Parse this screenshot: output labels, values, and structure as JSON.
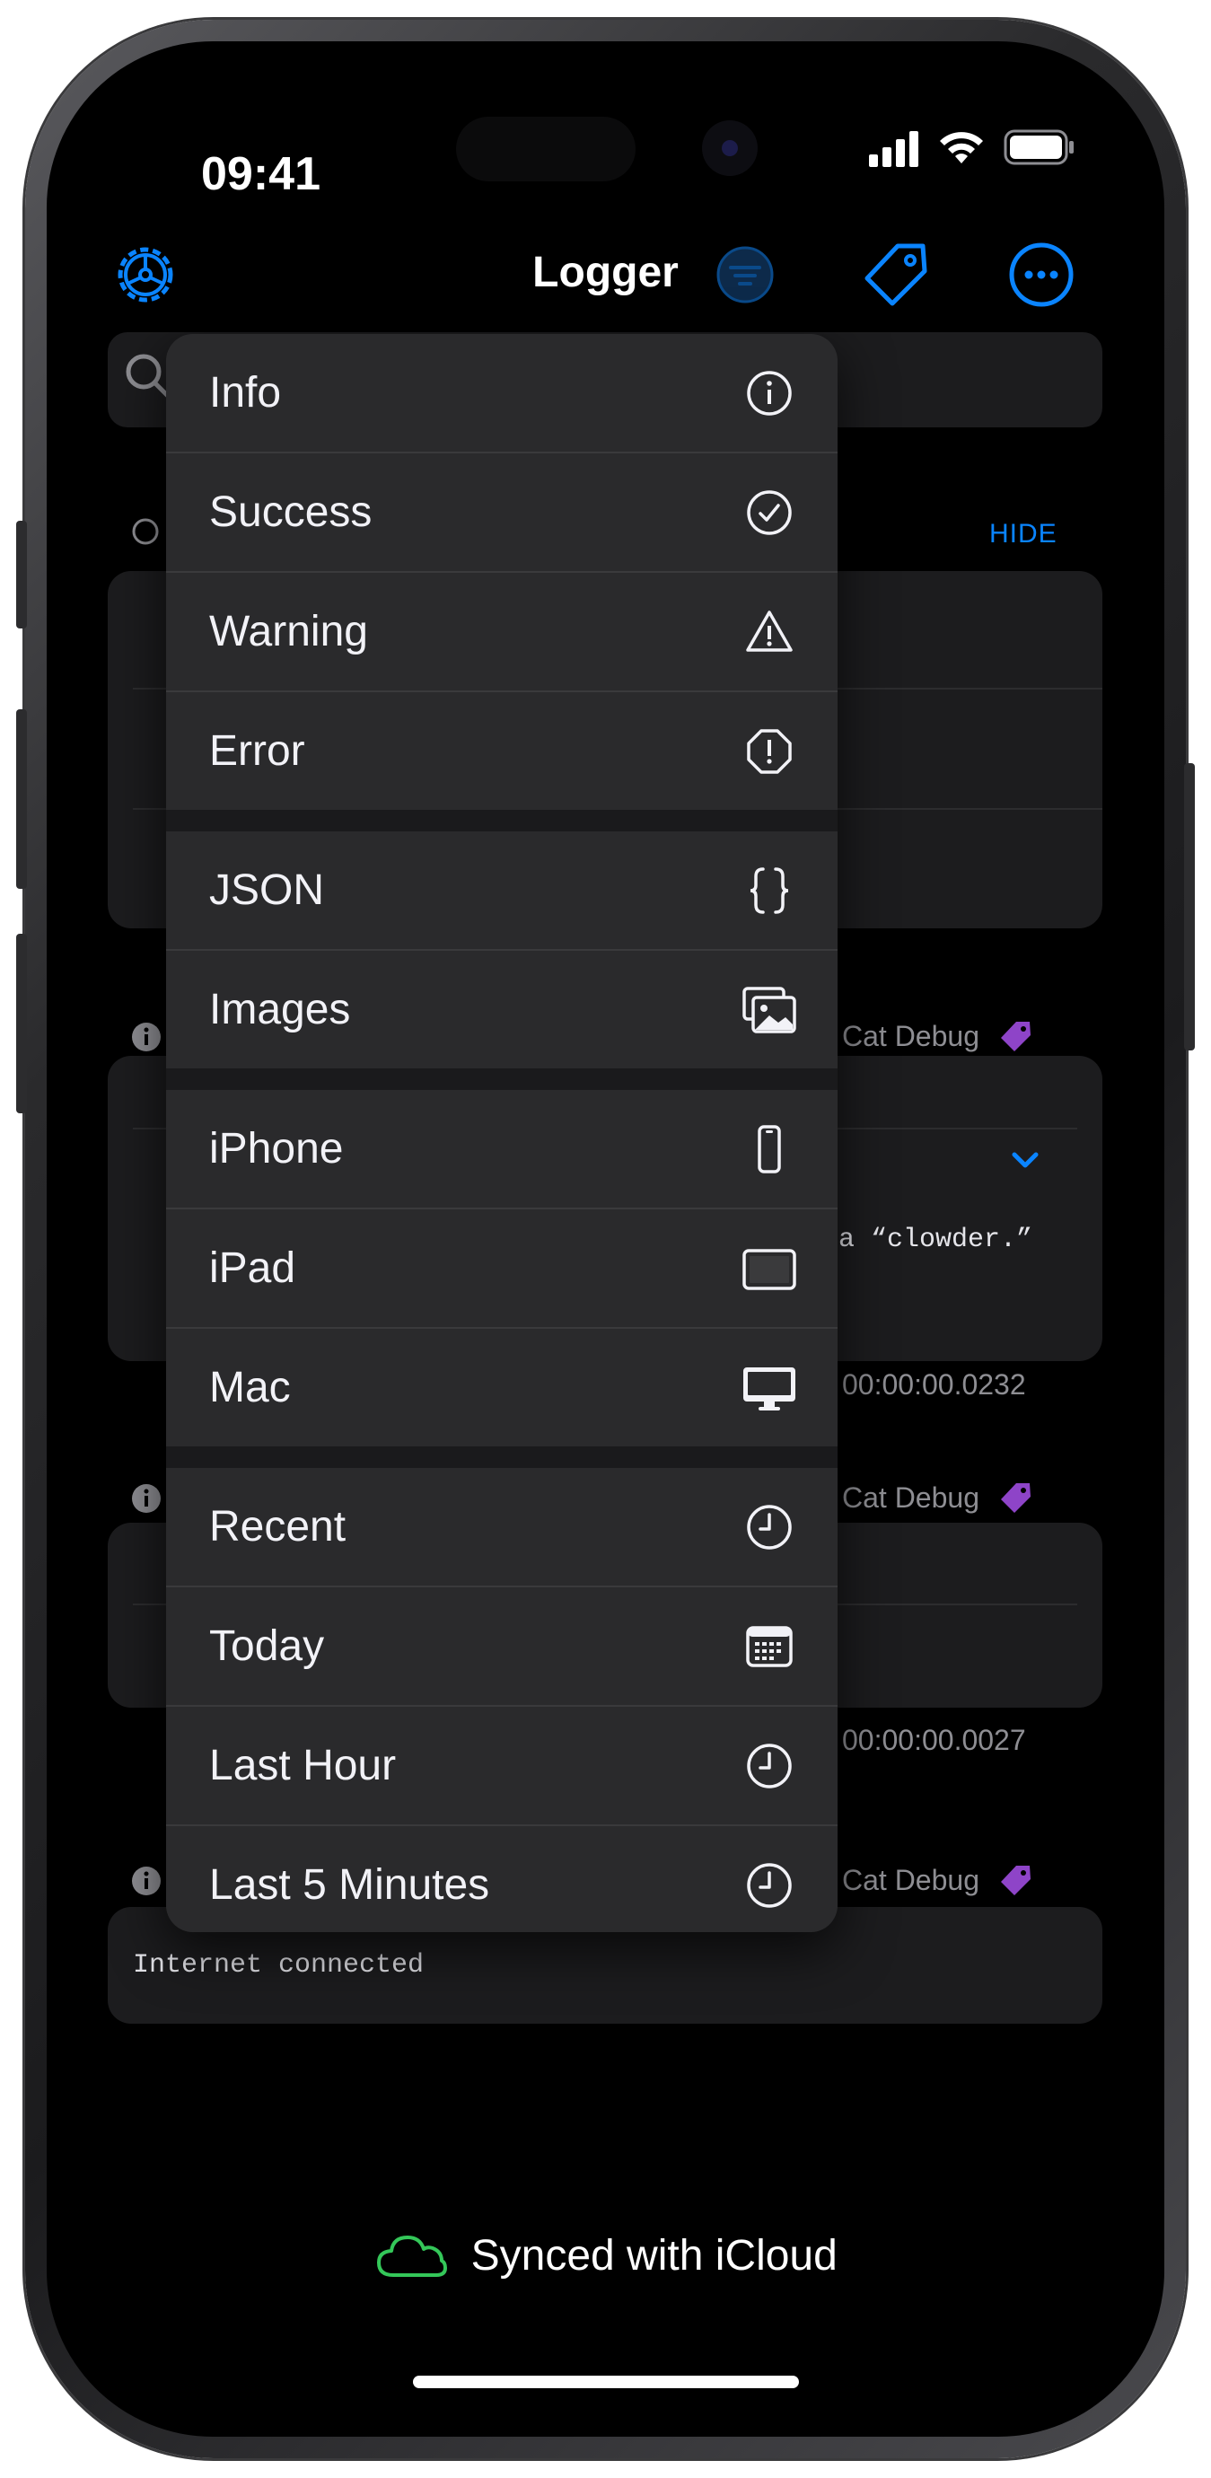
{
  "status_bar": {
    "time": "09:41"
  },
  "nav": {
    "title": "Logger"
  },
  "section": {
    "hide_label": "HIDE"
  },
  "entries": [
    {
      "category": "Cat Debug",
      "code_suffix": "a “clowder.”",
      "duration": "00:00:00.0232"
    },
    {
      "category": "Cat Debug",
      "duration": "00:00:00.0027"
    },
    {
      "category": "Cat Debug",
      "message": "Internet connected"
    }
  ],
  "menu": {
    "items": [
      {
        "label": "Info",
        "icon": "info-circle-icon"
      },
      {
        "label": "Success",
        "icon": "checkmark-circle-icon"
      },
      {
        "label": "Warning",
        "icon": "warning-triangle-icon"
      },
      {
        "label": "Error",
        "icon": "error-octagon-icon"
      },
      {
        "label": "JSON",
        "icon": "curly-braces-icon"
      },
      {
        "label": "Images",
        "icon": "photos-icon"
      },
      {
        "label": "iPhone",
        "icon": "iphone-icon"
      },
      {
        "label": "iPad",
        "icon": "ipad-icon"
      },
      {
        "label": "Mac",
        "icon": "desktop-icon"
      },
      {
        "label": "Recent",
        "icon": "clock-icon"
      },
      {
        "label": "Today",
        "icon": "calendar-icon"
      },
      {
        "label": "Last Hour",
        "icon": "clock-icon"
      },
      {
        "label": "Last 5 Minutes",
        "icon": "clock-icon"
      }
    ]
  },
  "footer": {
    "sync_text": "Synced with iCloud"
  },
  "colors": {
    "accent": "#0a84ff",
    "tag": "#8e44c8",
    "cloud": "#34c759",
    "background": "#000000"
  }
}
